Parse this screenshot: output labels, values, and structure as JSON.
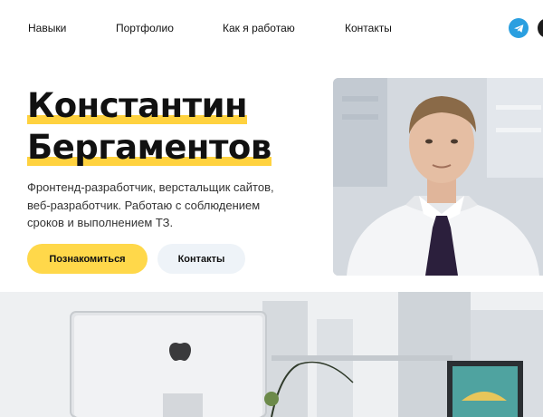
{
  "nav": {
    "items": [
      {
        "label": "Навыки"
      },
      {
        "label": "Портфолио"
      },
      {
        "label": "Как я работаю"
      },
      {
        "label": "Контакты"
      }
    ],
    "social": [
      "telegram-icon",
      "social-icon"
    ]
  },
  "hero": {
    "name_line1": "Константин",
    "name_line2": "Бергаментов",
    "description": "Фронтенд-разработчик, верстальщик сайтов, веб-разработчик. Работаю с соблюдением сроков и выполнением ТЗ.",
    "primary_button": "Познакомиться",
    "secondary_button": "Контакты"
  },
  "colors": {
    "accent": "#ffd23f",
    "button_primary": "#ffd84a",
    "button_secondary": "#eef3f8",
    "telegram": "#2a9fe0",
    "text": "#111111"
  }
}
